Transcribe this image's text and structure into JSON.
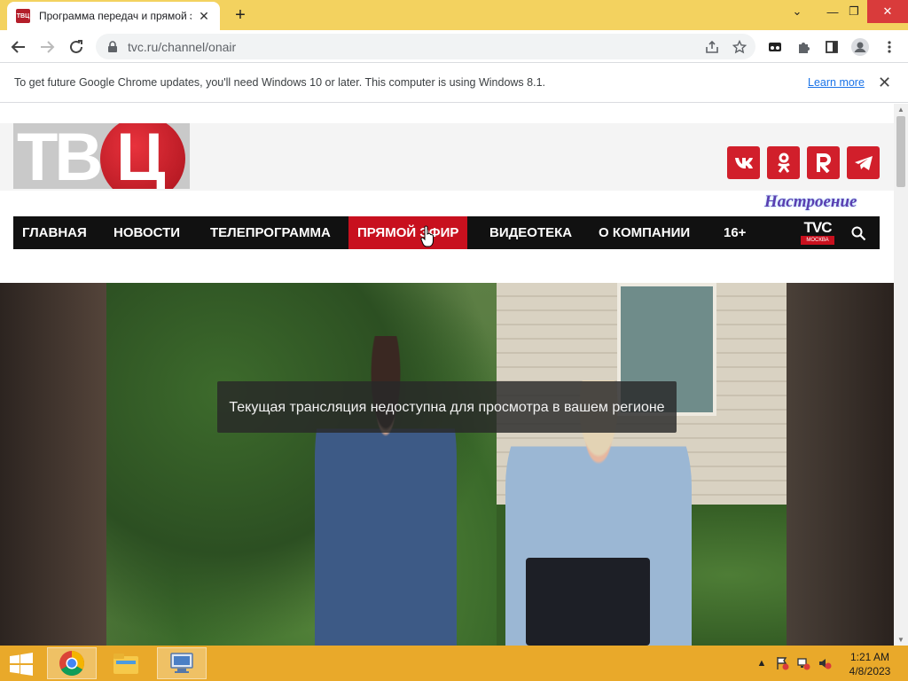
{
  "browser": {
    "tab": {
      "title": "Программа передач и прямой э",
      "favicon_text": "ТВЦ"
    },
    "address": {
      "url": "tvc.ru/channel/onair"
    }
  },
  "infobar": {
    "message": "To get future Google Chrome updates, you'll need Windows 10 or later. This computer is using Windows 8.1.",
    "link": "Learn more"
  },
  "site": {
    "logo_text": "ТВ",
    "logo_circle_text": "Ц",
    "social": [
      {
        "name": "vk",
        "label": "vk"
      },
      {
        "name": "ok",
        "label": "ок"
      },
      {
        "name": "rutube",
        "label": "R"
      },
      {
        "name": "telegram",
        "label": "➤"
      }
    ],
    "nastroenie": "Настроение",
    "nav": [
      {
        "label": "ГЛАВНАЯ",
        "active": false
      },
      {
        "label": "НОВОСТИ",
        "active": false
      },
      {
        "label": "ТЕЛЕПРОГРАММА",
        "active": false
      },
      {
        "label": "ПРЯМОЙ ЭФИР",
        "active": true
      },
      {
        "label": "ВИДЕОТЕКА",
        "active": false
      },
      {
        "label": "О КОМПАНИИ",
        "active": false
      },
      {
        "label": "16+",
        "active": false
      }
    ],
    "tvc_logo": {
      "text": "TVC",
      "sub": "МОСКВА"
    },
    "player_message": "Текущая трансляция недоступна для просмотра в вашем регионе"
  },
  "taskbar": {
    "apps": [
      "chrome-icon",
      "file-explorer-icon",
      "remote-desktop-icon"
    ],
    "clock": {
      "time": "1:21 AM",
      "date": "4/8/2023"
    }
  },
  "colors": {
    "accent_red": "#c8101e",
    "chrome_frame": "#f3d25f",
    "taskbar": "#e9a92a"
  }
}
